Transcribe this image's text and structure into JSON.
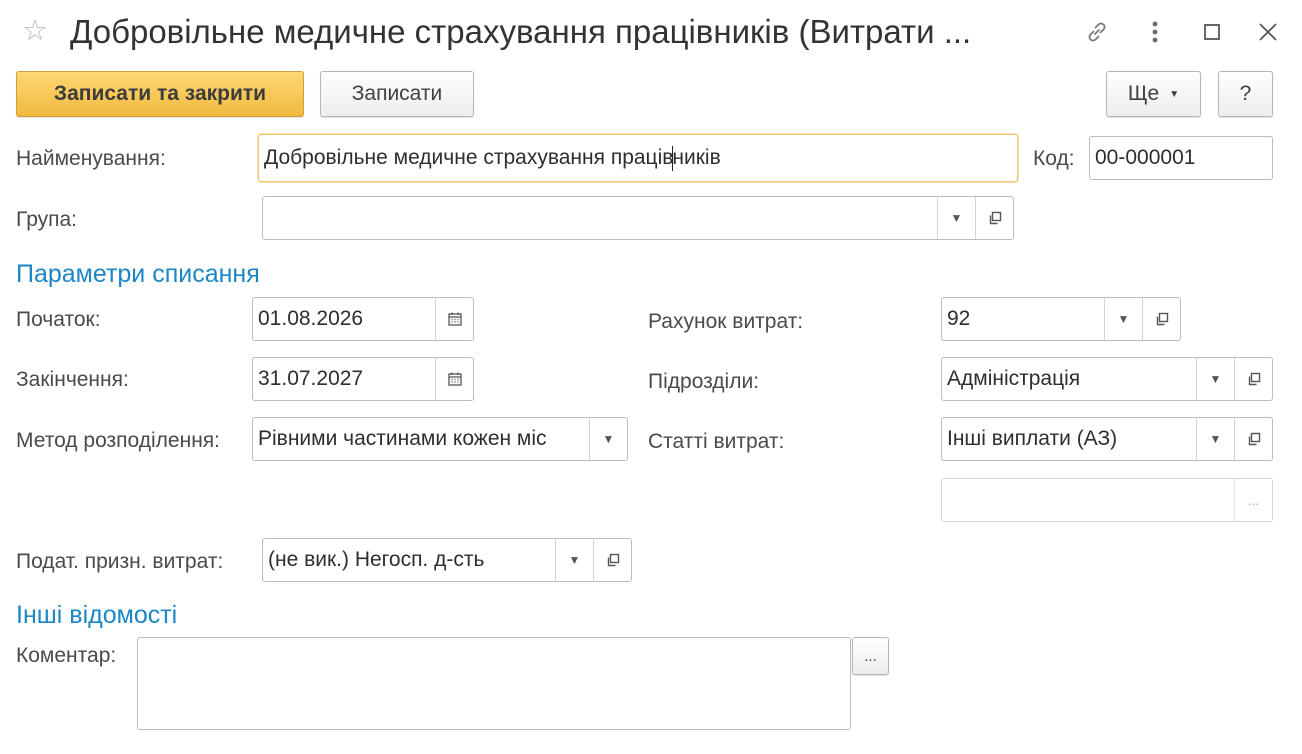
{
  "window": {
    "title": "Добровільне медичне страхування працівників (Витрати ...",
    "icons": [
      "star-icon",
      "link-icon",
      "more-icon",
      "maximize-icon",
      "close-icon"
    ]
  },
  "toolbar": {
    "save_close_label": "Записати та закрити",
    "save_label": "Записати",
    "more_label": "Ще",
    "help_label": "?"
  },
  "form": {
    "name_label": "Найменування:",
    "name_value_before_cursor": "Добровільне медичне страхування праців",
    "name_value_after_cursor": "ників",
    "code_label": "Код:",
    "code_value": "00-000001",
    "group_label": "Група:",
    "group_value": ""
  },
  "writeoff": {
    "section_title": "Параметри списання",
    "start_label": "Початок:",
    "start_value": "01.08.2026",
    "end_label": "Закінчення:",
    "end_value": "31.07.2027",
    "method_label": "Метод розподілення:",
    "method_value": "Рівними частинами кожен міс",
    "account_label": "Рахунок витрат:",
    "account_value": "92",
    "division_label": "Підрозділи:",
    "division_value": "Адміністрація",
    "expense_item_label": "Статті витрат:",
    "expense_item_value": "Інші виплати  (АЗ)",
    "extra_value": "",
    "tax_label": "Подат. призн. витрат:",
    "tax_value": "(не вик.) Негосп. д-сть"
  },
  "other": {
    "section_title": "Інші відомості",
    "comment_label": "Коментар:",
    "comment_value": "",
    "ellipsis": "..."
  },
  "colors": {
    "accent_section": "#1c86c6",
    "primary_button": "#f2b93f",
    "focus_border": "#f0c56e"
  }
}
